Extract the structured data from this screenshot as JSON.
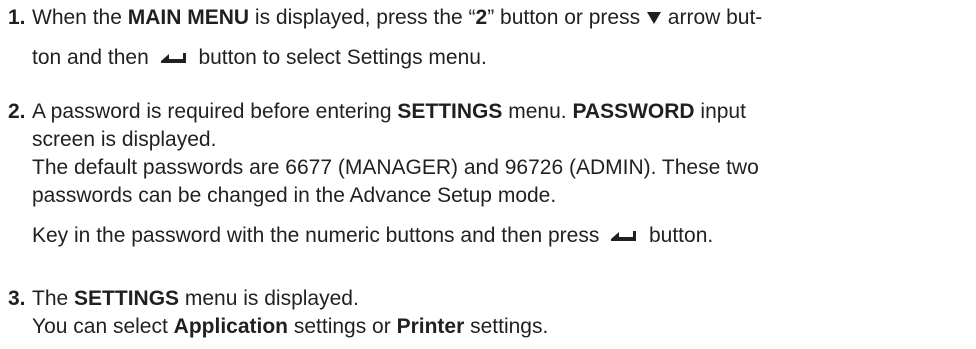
{
  "steps": [
    {
      "number": "1.",
      "line1": {
        "t1": "When the ",
        "b1": "MAIN MENU",
        "t2": " is displayed, press the “",
        "b2": "2",
        "t3": "” button or press ",
        "t4": " arrow but-"
      },
      "line2": {
        "t1": "ton and then ",
        "t2": " button to select Settings menu."
      }
    },
    {
      "number": "2.",
      "line1": {
        "t1": "A password is required before entering ",
        "b1": "SETTINGS",
        "t2": " menu. ",
        "b2": "PASSWORD",
        "t3": " input"
      },
      "line2": "screen is displayed.",
      "line3": "The default passwords are 6677 (MANAGER) and 96726 (ADMIN). These two",
      "line4": "passwords can be changed in the Advance Setup mode.",
      "line5": {
        "t1": "Key in the password with the numeric buttons and then press ",
        "t2": " button."
      }
    },
    {
      "number": "3.",
      "line1": {
        "t1": "The ",
        "b1": "SETTINGS",
        "t2": " menu is displayed."
      },
      "line2": {
        "t1": "You can select ",
        "b1": "Application",
        "t2": " settings or ",
        "b2": "Printer",
        "t3": " settings."
      }
    }
  ],
  "icons": {
    "down_arrow": "down-triangle-icon",
    "enter": "enter-icon"
  }
}
